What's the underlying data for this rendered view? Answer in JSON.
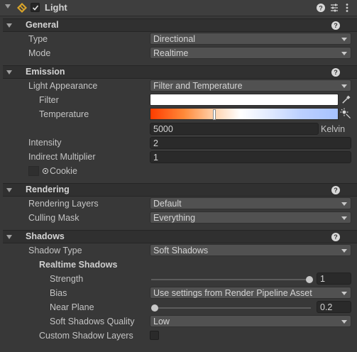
{
  "component": {
    "title": "Light",
    "enabled": true
  },
  "sections": {
    "general": {
      "title": "General",
      "type_label": "Type",
      "type_value": "Directional",
      "mode_label": "Mode",
      "mode_value": "Realtime"
    },
    "emission": {
      "title": "Emission",
      "appearance_label": "Light Appearance",
      "appearance_value": "Filter and Temperature",
      "filter_label": "Filter",
      "temperature_label": "Temperature",
      "temperature_value": "5000",
      "temperature_unit": "Kelvin",
      "intensity_label": "Intensity",
      "intensity_value": "2",
      "indirect_label": "Indirect Multiplier",
      "indirect_value": "1",
      "cookie_label": "Cookie"
    },
    "rendering": {
      "title": "Rendering",
      "layers_label": "Rendering Layers",
      "layers_value": "Default",
      "culling_label": "Culling Mask",
      "culling_value": "Everything"
    },
    "shadows": {
      "title": "Shadows",
      "type_label": "Shadow Type",
      "type_value": "Soft Shadows",
      "realtime_label": "Realtime Shadows",
      "strength_label": "Strength",
      "strength_value": "1",
      "bias_label": "Bias",
      "bias_value": "Use settings from Render Pipeline Asset",
      "near_label": "Near Plane",
      "near_value": "0.2",
      "quality_label": "Soft Shadows Quality",
      "quality_value": "Low",
      "custom_label": "Custom Shadow Layers"
    }
  },
  "colors": {
    "panel": "#383838",
    "section_header": "#303030",
    "dropdown": "#515151",
    "field": "#2a2a2a",
    "filter_color": "#ffffff"
  },
  "sliders": {
    "strength_fraction": 1.0,
    "near_plane_fraction": 0.0
  },
  "icons": [
    "light-component-icon",
    "help-icon",
    "preset-icon",
    "more-icon",
    "eyedropper-icon",
    "sun-icon",
    "cookie-object-icon"
  ]
}
